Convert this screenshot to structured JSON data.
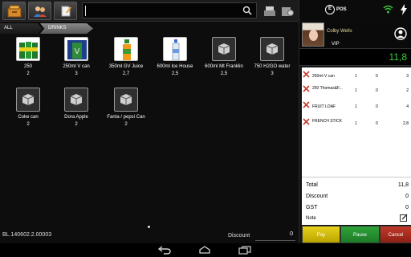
{
  "search": {
    "value": "",
    "placeholder": ""
  },
  "breadcrumb": {
    "all": "ALL",
    "drinks": "DRINKS"
  },
  "products": [
    {
      "name": "250",
      "price": "2",
      "thumb": "cans-green"
    },
    {
      "name": "250ml V can",
      "price": "3",
      "thumb": "can-blue"
    },
    {
      "name": "350ml GV Juice",
      "price": "2,7",
      "thumb": "bottle-orange"
    },
    {
      "name": "600ml Ice House",
      "price": "2,5",
      "thumb": "bottle-water"
    },
    {
      "name": "600ml Mt Franklin",
      "price": "2,5",
      "thumb": "box"
    },
    {
      "name": "750 H2GO water",
      "price": "3",
      "thumb": "box"
    },
    {
      "name": "Coke can",
      "price": "2",
      "thumb": "box"
    },
    {
      "name": "Dora Apple",
      "price": "2",
      "thumb": "box"
    },
    {
      "name": "Fanta / pepsi Can",
      "price": "2",
      "thumb": "box"
    }
  ],
  "footer": {
    "id": "BL.140602.2.00003",
    "discount_label": "Discount",
    "discount_value": "0"
  },
  "status": {
    "logo_mark": "E",
    "logo_text": "POS"
  },
  "customer": {
    "name": "Colby Wells",
    "tier": "VIP"
  },
  "order_total": "11,8",
  "order_items": [
    {
      "name": "250ml V can",
      "qty": "1",
      "discount": "0",
      "total": "3"
    },
    {
      "name": "250 Thomas&F...",
      "qty": "1",
      "discount": "0",
      "total": "2"
    },
    {
      "name": "FRUIT LOAF",
      "qty": "1",
      "discount": "0",
      "total": "4"
    },
    {
      "name": "FRENCH STICK",
      "qty": "1",
      "discount": "0",
      "total": "2,8"
    }
  ],
  "summary": {
    "total_label": "Total",
    "total_value": "11,8",
    "discount_label": "Discount",
    "discount_value": "0",
    "gst_label": "GST",
    "gst_value": "0",
    "note_label": "Note"
  },
  "actions": {
    "pay": "Pay",
    "pause": "Pause",
    "cancel": "Cancel"
  },
  "colors": {
    "total_green": "#36d13a",
    "pay": "#d9c300",
    "pause": "#2a9a35",
    "cancel": "#b23325",
    "customer_name": "#e8dca0"
  },
  "icons": [
    "cash-drawer-icon",
    "customers-icon",
    "notes-icon",
    "search-icon",
    "printer-icon",
    "settings-icon",
    "wifi-icon",
    "charging-icon",
    "user-profile-icon",
    "remove-item-icon",
    "edit-note-icon",
    "back-icon",
    "home-icon",
    "recent-apps-icon"
  ]
}
